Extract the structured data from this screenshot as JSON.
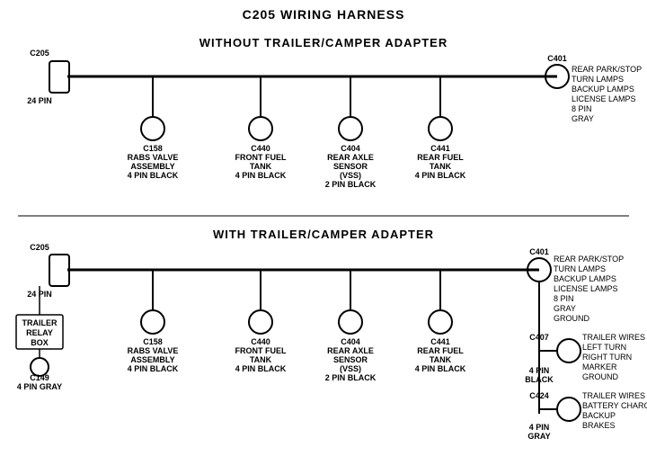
{
  "title": "C205 WIRING HARNESS",
  "top_section": {
    "label": "WITHOUT  TRAILER/CAMPER  ADAPTER",
    "left_connector": {
      "id": "C205",
      "pin_label": "24 PIN"
    },
    "right_connector": {
      "id": "C401",
      "pin_label": "8 PIN",
      "color": "GRAY",
      "desc": [
        "REAR PARK/STOP",
        "TURN LAMPS",
        "BACKUP LAMPS",
        "LICENSE LAMPS"
      ]
    },
    "connectors": [
      {
        "id": "C158",
        "desc": [
          "RABS VALVE",
          "ASSEMBLY",
          "4 PIN BLACK"
        ]
      },
      {
        "id": "C440",
        "desc": [
          "FRONT FUEL",
          "TANK",
          "4 PIN BLACK"
        ]
      },
      {
        "id": "C404",
        "desc": [
          "REAR AXLE",
          "SENSOR",
          "(VSS)",
          "2 PIN BLACK"
        ]
      },
      {
        "id": "C441",
        "desc": [
          "REAR FUEL",
          "TANK",
          "4 PIN BLACK"
        ]
      }
    ]
  },
  "bottom_section": {
    "label": "WITH  TRAILER/CAMPER  ADAPTER",
    "left_connector": {
      "id": "C205",
      "pin_label": "24 PIN"
    },
    "extra_connector": {
      "id": "C149",
      "pin_label": "4 PIN GRAY",
      "box_label": "TRAILER\nRELAY\nBOX"
    },
    "right_connector": {
      "id": "C401",
      "pin_label": "8 PIN",
      "color": "GRAY",
      "desc": [
        "REAR PARK/STOP",
        "TURN LAMPS",
        "BACKUP LAMPS",
        "LICENSE LAMPS",
        "GROUND"
      ]
    },
    "right_connectors": [
      {
        "id": "C407",
        "pin_label": "4 PIN",
        "color": "BLACK",
        "desc": [
          "TRAILER WIRES",
          "LEFT TURN",
          "RIGHT TURN",
          "MARKER",
          "GROUND"
        ]
      },
      {
        "id": "C424",
        "pin_label": "4 PIN",
        "color": "GRAY",
        "desc": [
          "TRAILER WIRES",
          "BATTERY CHARGE",
          "BACKUP",
          "BRAKES"
        ]
      }
    ],
    "connectors": [
      {
        "id": "C158",
        "desc": [
          "RABS VALVE",
          "ASSEMBLY",
          "4 PIN BLACK"
        ]
      },
      {
        "id": "C440",
        "desc": [
          "FRONT FUEL",
          "TANK",
          "4 PIN BLACK"
        ]
      },
      {
        "id": "C404",
        "desc": [
          "REAR AXLE",
          "SENSOR",
          "(VSS)",
          "2 PIN BLACK"
        ]
      },
      {
        "id": "C441",
        "desc": [
          "REAR FUEL",
          "TANK",
          "4 PIN BLACK"
        ]
      }
    ]
  }
}
